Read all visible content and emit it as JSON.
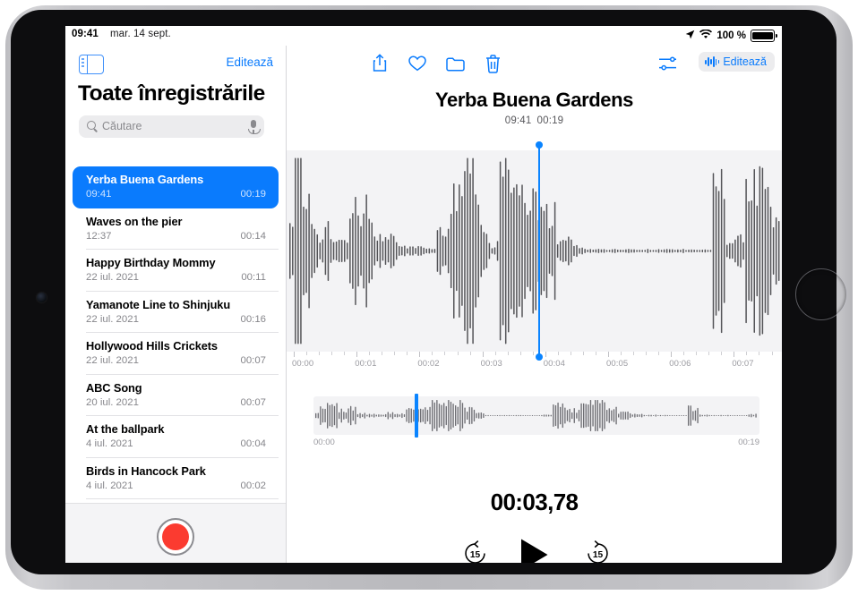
{
  "status_bar": {
    "time": "09:41",
    "date": "mar. 14 sept.",
    "battery_pct": "100 %",
    "location_icon": "location-arrow-icon",
    "wifi_icon": "wifi-icon",
    "battery_icon": "battery-full-icon"
  },
  "sidebar": {
    "toggle_icon": "sidebar-toggle-icon",
    "edit_label": "Editează",
    "title": "Toate înregistrările",
    "search": {
      "placeholder": "Căutare",
      "search_icon": "search-icon",
      "mic_icon": "microphone-icon"
    },
    "record_button": "record-button",
    "recordings": [
      {
        "name": "Yerba Buena Gardens",
        "date": "09:41",
        "duration": "00:19",
        "selected": true
      },
      {
        "name": "Waves on the pier",
        "date": "12:37",
        "duration": "00:14",
        "selected": false
      },
      {
        "name": "Happy Birthday Mommy",
        "date": "22 iul. 2021",
        "duration": "00:11",
        "selected": false
      },
      {
        "name": "Yamanote Line to Shinjuku",
        "date": "22 iul. 2021",
        "duration": "00:16",
        "selected": false
      },
      {
        "name": "Hollywood Hills Crickets",
        "date": "22 iul. 2021",
        "duration": "00:07",
        "selected": false
      },
      {
        "name": "ABC Song",
        "date": "20 iul. 2021",
        "duration": "00:07",
        "selected": false
      },
      {
        "name": "At the ballpark",
        "date": "4 iul. 2021",
        "duration": "00:04",
        "selected": false
      },
      {
        "name": "Birds in Hancock Park",
        "date": "4 iul. 2021",
        "duration": "00:02",
        "selected": false
      }
    ]
  },
  "detail": {
    "toolbar": {
      "share_icon": "share-icon",
      "favorite_icon": "heart-icon",
      "folder_icon": "folder-icon",
      "delete_icon": "trash-icon",
      "enhance_icon": "audio-settings-icon",
      "edit_label": "Editează",
      "edit_waveform_icon": "waveform-icon"
    },
    "title": "Yerba Buena Gardens",
    "time": "09:41",
    "duration": "00:19",
    "current_time": "00:03,78",
    "axis_labels": [
      "00:00",
      "00:01",
      "00:02",
      "00:03",
      "00:04",
      "00:05",
      "00:06",
      "00:07"
    ],
    "overview_start": "00:00",
    "overview_end": "00:19",
    "controls": {
      "skip_back_label": "15",
      "skip_back_icon": "skip-back-15-icon",
      "play_icon": "play-icon",
      "skip_forward_label": "15",
      "skip_forward_icon": "skip-forward-15-icon"
    },
    "accent_color": "#0a7bfd",
    "playhead_color": "#0a84ff",
    "record_color": "#fb3b30",
    "waveform_color": "#545458"
  },
  "multitask_icon": "multitask-handle-icon"
}
